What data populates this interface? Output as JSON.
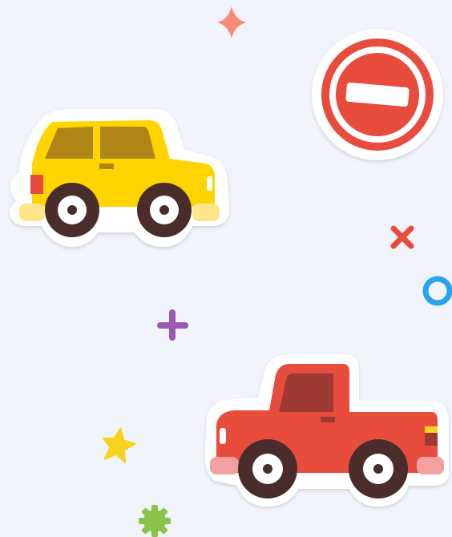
{
  "scene": {
    "background": "#f1f5fb",
    "sticker_outline": "#ffffff",
    "stickers": [
      {
        "id": "yellow-car",
        "kind": "car",
        "body_color": "#ffd400",
        "window_color": "#b08517",
        "wheel_color": "#4a2c2a"
      },
      {
        "id": "red-pickup",
        "kind": "pickup-truck",
        "body_color": "#e74c3c",
        "window_color": "#9c3a33",
        "wheel_color": "#4a2c2a"
      },
      {
        "id": "no-entry-sign",
        "kind": "no-entry-sign",
        "color": "#e74c3c"
      }
    ],
    "decorations": [
      {
        "id": "sparkle",
        "color": "#f98b7a"
      },
      {
        "id": "x-mark",
        "color": "#e74c3c"
      },
      {
        "id": "ring",
        "color": "#29a3ee"
      },
      {
        "id": "plus",
        "color": "#9b59b6"
      },
      {
        "id": "star",
        "color": "#f7d31e"
      },
      {
        "id": "gear",
        "color": "#8bc34a"
      }
    ]
  }
}
